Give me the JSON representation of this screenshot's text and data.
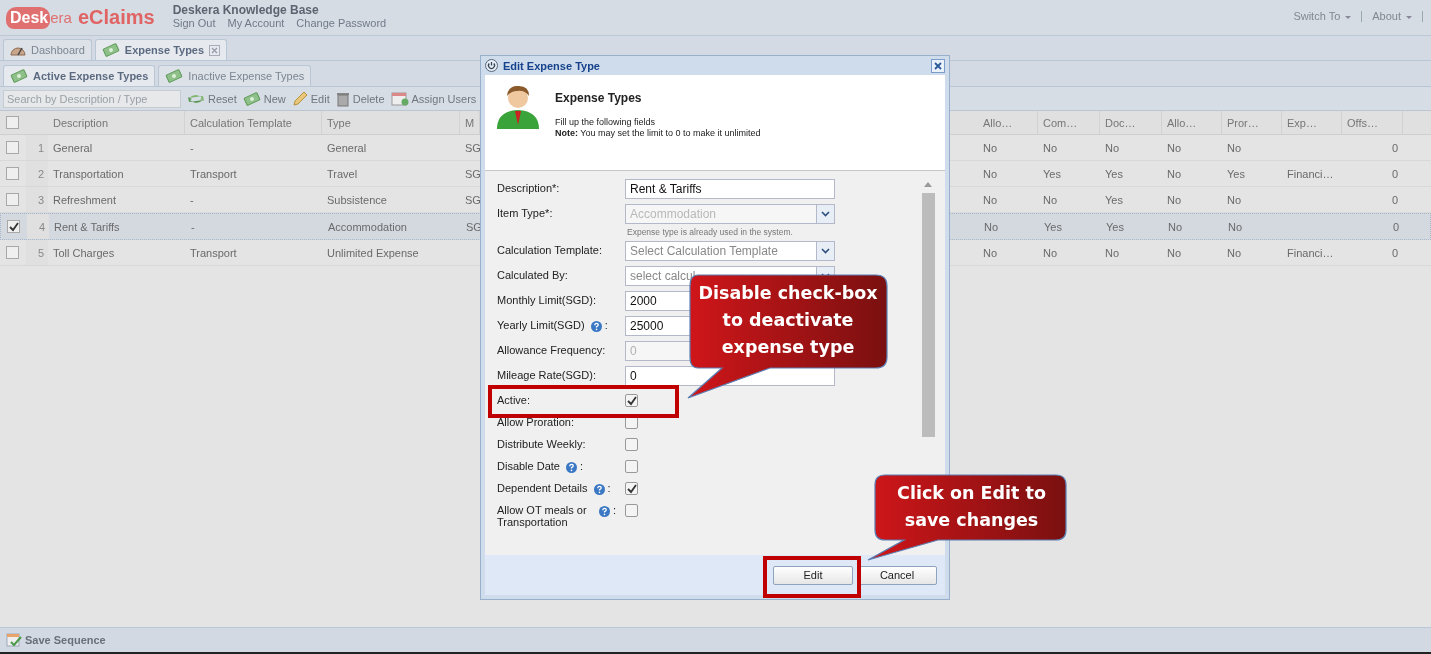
{
  "header": {
    "logo_mark": "Desk",
    "logo_rest": "era",
    "product": "eClaims",
    "title": "Deskera Knowledge Base",
    "links": [
      "Sign Out",
      "My Account",
      "Change Password"
    ],
    "menus": [
      "Switch To",
      "About"
    ]
  },
  "tabs": [
    {
      "label": "Dashboard",
      "kind": "dashboard",
      "selected": false,
      "closable": false
    },
    {
      "label": "Expense Types",
      "kind": "money",
      "selected": true,
      "closable": true
    }
  ],
  "subtabs": [
    {
      "label": "Active Expense Types",
      "selected": true
    },
    {
      "label": "Inactive Expense Types",
      "selected": false
    }
  ],
  "toolbar": {
    "search_placeholder": "Search by Description / Type",
    "buttons": [
      {
        "label": "Reset",
        "kind": "reset"
      },
      {
        "label": "New",
        "kind": "new"
      },
      {
        "label": "Edit",
        "kind": "edit"
      },
      {
        "label": "Delete",
        "kind": "delete"
      },
      {
        "label": "Assign Users",
        "kind": "assign"
      }
    ]
  },
  "grid": {
    "left_columns": [
      "Description",
      "Calculation Template",
      "Type",
      "M"
    ],
    "right_columns": [
      "Allo…",
      "Com…",
      "Doc…",
      "Allo…",
      "Pror…",
      "Exp…",
      "Offs…"
    ],
    "all_selected": false,
    "rows": [
      {
        "number": "1",
        "selected": false,
        "description": "General",
        "template": "-",
        "type": "General",
        "m": "SG",
        "allo": "No",
        "com": "No",
        "doc": "No",
        "allo2": "No",
        "pror": "No",
        "offs": "0"
      },
      {
        "number": "2",
        "selected": false,
        "description": "Transportation",
        "template": "Transport",
        "type": "Travel",
        "m": "SG",
        "allo": "No",
        "com": "Yes",
        "doc": "Yes",
        "allo2": "No",
        "pror": "Yes",
        "exp": "Financi…",
        "offs": "0"
      },
      {
        "number": "3",
        "selected": false,
        "description": "Refreshment",
        "template": "-",
        "type": "Subsistence",
        "m": "SG",
        "allo": "No",
        "com": "No",
        "doc": "Yes",
        "allo2": "No",
        "pror": "No",
        "offs": "0"
      },
      {
        "number": "4",
        "selected": true,
        "description": "Rent & Tariffs",
        "template": "-",
        "type": "Accommodation",
        "m": "SG",
        "allo": "No",
        "com": "Yes",
        "doc": "Yes",
        "allo2": "No",
        "pror": "No",
        "offs": "0"
      },
      {
        "number": "5",
        "selected": false,
        "description": "Toll Charges",
        "template": "Transport",
        "type": "Unlimited Expense",
        "allo": "No",
        "com": "No",
        "doc": "No",
        "allo2": "No",
        "pror": "No",
        "exp": "Financi…",
        "offs": "0"
      }
    ]
  },
  "footer": {
    "label": "Save Sequence"
  },
  "dialog": {
    "title": "Edit Expense Type",
    "heading": "Expense Types",
    "intro": "Fill up the following fields",
    "note": "**Note:** You may set the limit to 0 to make it unlimited",
    "fields": [
      {
        "kind": "text",
        "label": "Description*:",
        "value": "Rent & Tariffs",
        "disabled": false
      },
      {
        "kind": "combo",
        "label": "Item Type*:",
        "value": "Accommodation",
        "disabled": true,
        "hint": "Expense type is already used in the system."
      },
      {
        "kind": "combo",
        "label": "Calculation Template:",
        "placeholder": "Select Calculation Template",
        "disabled": false
      },
      {
        "kind": "combo",
        "label": "Calculated By:",
        "placeholder": "select calcul",
        "disabled": false
      },
      {
        "kind": "text",
        "label": "Monthly Limit(SGD):",
        "value": "2000",
        "disabled": false
      },
      {
        "kind": "text",
        "label": "Yearly Limit(SGD)",
        "help": true,
        "suffix": ":",
        "value": "25000",
        "disabled": false
      },
      {
        "kind": "text",
        "label": "Allowance Frequency:",
        "value": "0",
        "disabled": true
      },
      {
        "kind": "text",
        "label": "Mileage Rate(SGD):",
        "value": "0",
        "disabled": false
      },
      {
        "kind": "checkbox",
        "label": "Active:",
        "checked": true
      },
      {
        "kind": "checkbox",
        "label": "Allow Proration:",
        "checked": false
      },
      {
        "kind": "checkbox",
        "label": "Distribute Weekly:",
        "checked": false
      },
      {
        "kind": "checkbox",
        "label": "Disable Date",
        "help": true,
        "suffix": ":",
        "checked": false
      },
      {
        "kind": "checkbox",
        "label": "Dependent Details",
        "help": true,
        "suffix": ":",
        "checked": true
      },
      {
        "kind": "checkbox",
        "label": "Allow OT meals or Transportation",
        "help": true,
        "suffix": ":",
        "checked": false
      }
    ],
    "buttons": [
      "Edit",
      "Cancel"
    ]
  },
  "callouts": [
    {
      "text": "Disable check-box to deactivate expense type",
      "kind": "checkbox"
    },
    {
      "text": "Click on Edit to save changes",
      "kind": "button"
    }
  ]
}
